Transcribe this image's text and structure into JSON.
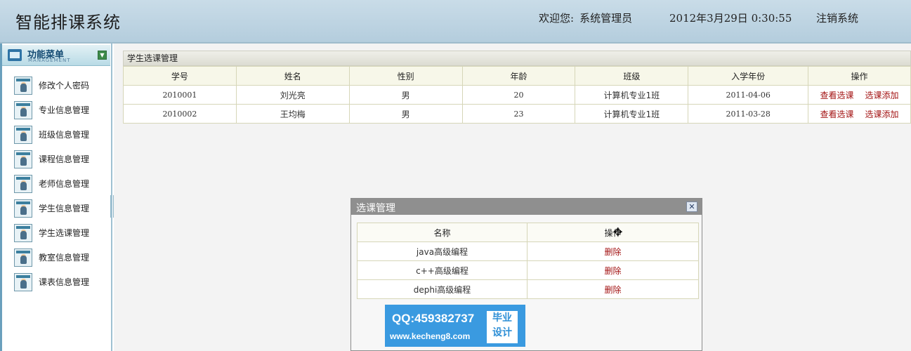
{
  "header": {
    "title": "智能排课系统",
    "welcome_label": "欢迎您:",
    "user": "系统管理员",
    "datetime": "2012年3月29日  0:30:55",
    "logout_label": "注销系统"
  },
  "sidebar": {
    "menu_title": "功能菜单",
    "menu_subtitle": "MANAGEMENT",
    "items": [
      {
        "label": "修改个人密码"
      },
      {
        "label": "专业信息管理"
      },
      {
        "label": "班级信息管理"
      },
      {
        "label": "课程信息管理"
      },
      {
        "label": "老师信息管理"
      },
      {
        "label": "学生信息管理"
      },
      {
        "label": "学生选课管理"
      },
      {
        "label": "教室信息管理"
      },
      {
        "label": "课表信息管理"
      }
    ]
  },
  "main": {
    "panel_title": "学生选课管理",
    "columns": [
      "学号",
      "姓名",
      "性别",
      "年龄",
      "班级",
      "入学年份",
      "操作"
    ],
    "rows": [
      {
        "id": "2010001",
        "name": "刘光亮",
        "gender": "男",
        "age": "20",
        "class": "计算机专业1班",
        "year": "2011-04-06"
      },
      {
        "id": "2010002",
        "name": "王均梅",
        "gender": "男",
        "age": "23",
        "class": "计算机专业1班",
        "year": "2011-03-28"
      }
    ],
    "actions": {
      "view": "查看选课",
      "add": "选课添加"
    }
  },
  "dialog": {
    "title": "选课管理",
    "close_glyph": "✕",
    "columns": [
      "名称",
      "操作"
    ],
    "rows": [
      {
        "name": "java高级编程",
        "action": "删除"
      },
      {
        "name": "c++高级编程",
        "action": "删除"
      },
      {
        "name": "dephi高级编程",
        "action": "删除"
      }
    ]
  },
  "watermark": {
    "qq": "QQ:459382737",
    "url": "www.kecheng8.com",
    "badge_line1": "毕业",
    "badge_line2": "设计"
  },
  "colors": {
    "header_bg": "#b4cddd",
    "link_red": "#a31313",
    "dialog_bar": "#8f8f8f",
    "watermark_blue": "#3a9ae0"
  }
}
